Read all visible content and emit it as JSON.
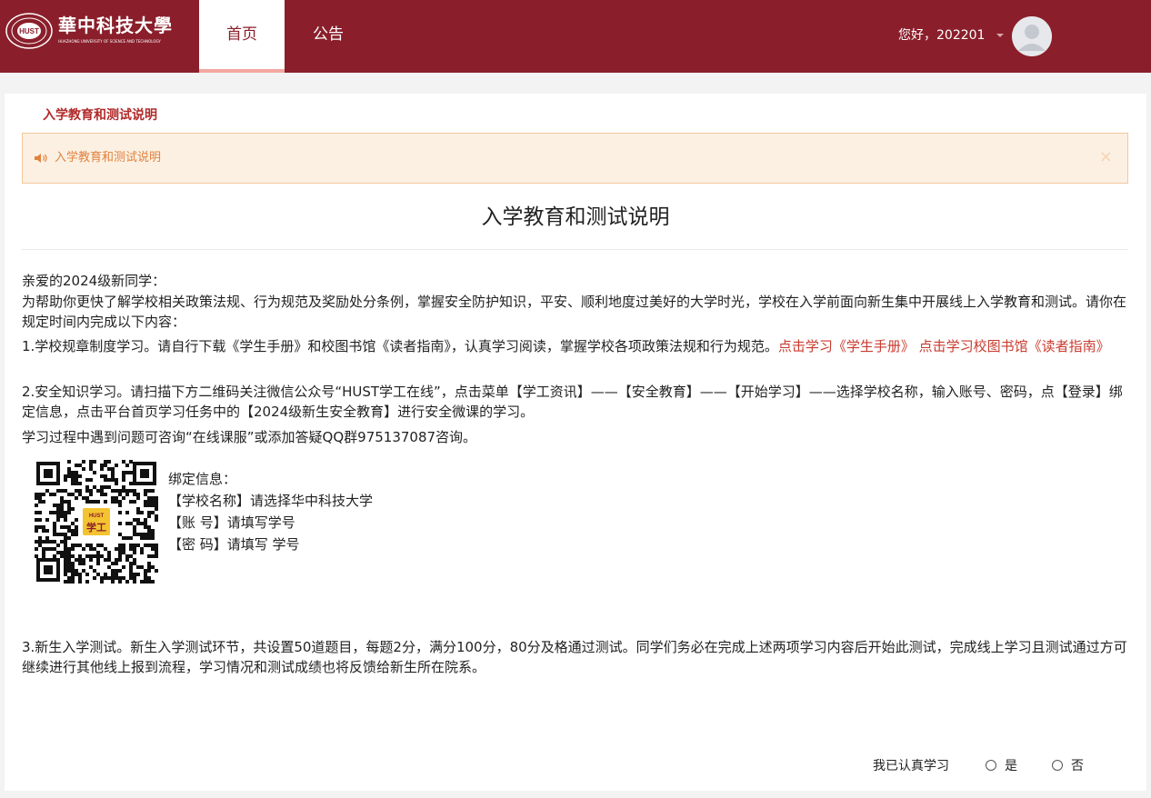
{
  "header": {
    "logo_name": "華中科技大學",
    "logo_en": "HUAZHONG UNIVERSITY OF SCIENCE AND TECHNOLOGY",
    "logo_seal_text": "HUST",
    "nav": [
      {
        "label": "首页",
        "active": true
      },
      {
        "label": "公告",
        "active": false
      }
    ],
    "user_greeting": "您好，202201"
  },
  "section_title": "入学教育和测试说明",
  "alert": {
    "text": "入学教育和测试说明",
    "close_symbol": "×"
  },
  "document": {
    "title": "入学教育和测试说明",
    "greeting": "亲爱的2024级新同学：",
    "intro": "为帮助你更快了解学校相关政策法规、行为规范及奖励处分条例，掌握安全防护知识，平安、顺利地度过美好的大学时光，学校在入学前面向新生集中开展线上入学教育和测试。请你在规定时间内完成以下内容：",
    "item1_text": "1.学校规章制度学习。请自行下载《学生手册》和校图书馆《读者指南》，认真学习阅读，掌握学校各项政策法规和行为规范。",
    "item1_link1": "点击学习《学生手册》",
    "item1_link2": "点击学习校图书馆《读者指南》",
    "item2_text": "2.安全知识学习。请扫描下方二维码关注微信公众号“HUST学工在线”，点击菜单【学工资讯】——【安全教育】——【开始学习】——选择学校名称，输入账号、密码，点【登录】绑定信息，点击平台首页学习任务中的【2024级新生安全教育】进行安全微课的学习。",
    "help_text": "学习过程中遇到问题可咨询“在线课服”或添加答疑QQ群975137087咨询。",
    "qr_badge_top": "HUST",
    "qr_badge_bottom": "学工",
    "bind_info": [
      "绑定信息：",
      "【学校名称】请选择华中科技大学",
      "【账 号】请填写学号",
      "【密 码】请填写 学号"
    ],
    "item3_text": "3.新生入学测试。新生入学测试环节，共设置50道题目，每题2分，满分100分，80分及格通过测试。同学们务必在完成上述两项学习内容后开始此测试，完成线上学习且测试通过方可继续进行其他线上报到流程，学习情况和测试成绩也将反馈给新生所在院系。"
  },
  "confirm": {
    "label": "我已认真学习",
    "options": [
      "是",
      "否"
    ]
  },
  "colors": {
    "header_bg": "#8a1f2b",
    "accent_red": "#c93b2e",
    "alert_bg": "#fcf0e2",
    "alert_text": "#e0823f"
  }
}
